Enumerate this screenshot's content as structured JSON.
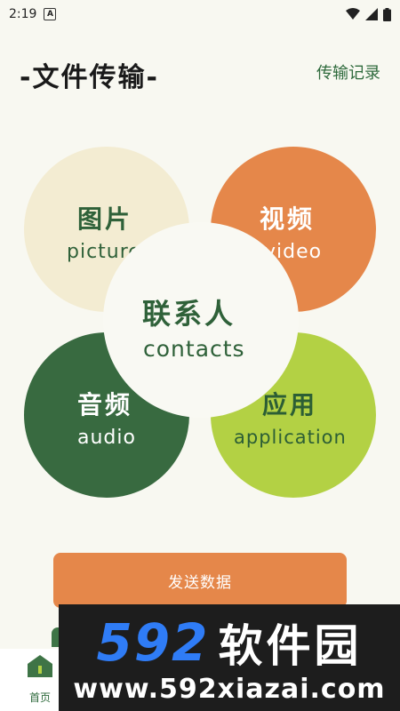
{
  "status_bar": {
    "time": "2:19",
    "notification_icon": "A"
  },
  "header": {
    "title": "-文件传输-",
    "history_link": "传输记录"
  },
  "categories": {
    "picture": {
      "zh": "图片",
      "en": "picture"
    },
    "video": {
      "zh": "视频",
      "en": "video"
    },
    "audio": {
      "zh": "音频",
      "en": "audio"
    },
    "application": {
      "zh": "应用",
      "en": "application"
    },
    "contacts": {
      "zh": "联系人",
      "en": "contacts"
    }
  },
  "actions": {
    "send_label": "发送数据"
  },
  "bottom_nav": {
    "home_label": "首页"
  },
  "watermark": {
    "logo_number": "592",
    "logo_text": "软件园",
    "url": "www.592xiazai.com"
  },
  "colors": {
    "background": "#f8f8f1",
    "green_dark": "#386a40",
    "orange": "#e5874a",
    "cream": "#f3ecd2",
    "lime": "#b3d144"
  },
  "icons": {
    "signal": "wifi-icon",
    "cellular": "cellular-signal-icon",
    "battery": "battery-icon",
    "home": "home-icon"
  }
}
